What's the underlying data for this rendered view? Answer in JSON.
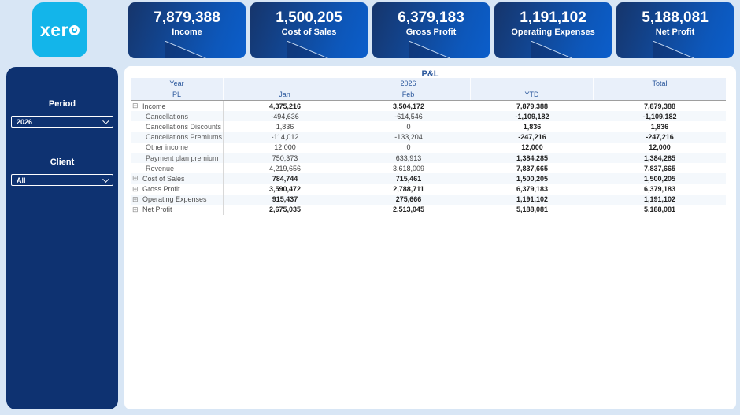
{
  "app": {
    "logo_text_prefix": "xer"
  },
  "kpi_cards": [
    {
      "value": "7,879,388",
      "label": "Income"
    },
    {
      "value": "1,500,205",
      "label": "Cost of Sales"
    },
    {
      "value": "6,379,183",
      "label": "Gross Profit"
    },
    {
      "value": "1,191,102",
      "label": "Operating Expenses"
    },
    {
      "value": "5,188,081",
      "label": "Net Profit"
    }
  ],
  "sidebar": {
    "period": {
      "label": "Period",
      "value": "2026"
    },
    "client": {
      "label": "Client",
      "value": "All"
    }
  },
  "pl": {
    "title": "P&L",
    "header": {
      "column_group": "Year",
      "row_group": "PL",
      "year_value": "2026",
      "month_1": "Jan",
      "month_2": "Feb",
      "ytd": "YTD",
      "total": "Total"
    },
    "rows": [
      {
        "label": "Income",
        "level": 0,
        "expander": "expanded",
        "bold": true,
        "jan": "4,375,216",
        "feb": "3,504,172",
        "ytd": "7,879,388",
        "total": "7,879,388"
      },
      {
        "label": "Cancellations",
        "level": 1,
        "expander": "",
        "bold": false,
        "jan": "-494,636",
        "feb": "-614,546",
        "ytd": "-1,109,182",
        "total": "-1,109,182"
      },
      {
        "label": "Cancellations Discounts",
        "level": 1,
        "expander": "",
        "bold": false,
        "jan": "1,836",
        "feb": "0",
        "ytd": "1,836",
        "total": "1,836"
      },
      {
        "label": "Cancellations Premiums",
        "level": 1,
        "expander": "",
        "bold": false,
        "jan": "-114,012",
        "feb": "-133,204",
        "ytd": "-247,216",
        "total": "-247,216"
      },
      {
        "label": "Other income",
        "level": 1,
        "expander": "",
        "bold": false,
        "jan": "12,000",
        "feb": "0",
        "ytd": "12,000",
        "total": "12,000"
      },
      {
        "label": "Payment plan premium",
        "level": 1,
        "expander": "",
        "bold": false,
        "jan": "750,373",
        "feb": "633,913",
        "ytd": "1,384,285",
        "total": "1,384,285"
      },
      {
        "label": "Revenue",
        "level": 1,
        "expander": "",
        "bold": false,
        "jan": "4,219,656",
        "feb": "3,618,009",
        "ytd": "7,837,665",
        "total": "7,837,665"
      },
      {
        "label": "Cost of Sales",
        "level": 0,
        "expander": "collapsed",
        "bold": true,
        "jan": "784,744",
        "feb": "715,461",
        "ytd": "1,500,205",
        "total": "1,500,205"
      },
      {
        "label": "Gross Profit",
        "level": 0,
        "expander": "collapsed",
        "bold": true,
        "jan": "3,590,472",
        "feb": "2,788,711",
        "ytd": "6,379,183",
        "total": "6,379,183"
      },
      {
        "label": "Operating Expenses",
        "level": 0,
        "expander": "collapsed",
        "bold": true,
        "jan": "915,437",
        "feb": "275,666",
        "ytd": "1,191,102",
        "total": "1,191,102"
      },
      {
        "label": "Net Profit",
        "level": 0,
        "expander": "collapsed",
        "bold": true,
        "jan": "2,675,035",
        "feb": "2,513,045",
        "ytd": "5,188,081",
        "total": "5,188,081"
      }
    ]
  },
  "colors": {
    "page_background": "#d8e6f5",
    "sidebar_navy": "#0e3271",
    "card_gradient_start": "#16356b",
    "card_gradient_end": "#0b5ecb",
    "xero_blue": "#13b5ea",
    "header_band": "#e9f0fa",
    "header_text": "#2a579c"
  }
}
